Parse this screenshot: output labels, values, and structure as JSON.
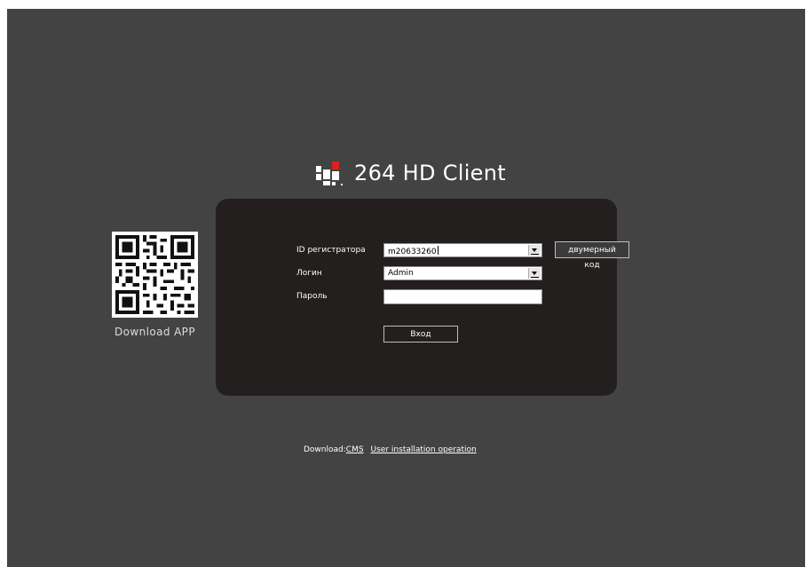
{
  "app": {
    "title": "264 HD Client"
  },
  "qr": {
    "caption": "Download APP"
  },
  "login": {
    "device_id_label": "ID регистратора",
    "device_id_value": "m20633260",
    "qr_code_button": "двумерный код",
    "login_label": "Логин",
    "login_value": "Admin",
    "password_label": "Пароль",
    "password_value": "",
    "submit_label": "Вход"
  },
  "footer": {
    "download_prefix": "Download:",
    "cms_link": "CMS",
    "install_link": "User installation operation"
  },
  "colors": {
    "background": "#434343",
    "panel": "#231f1e",
    "logo_red": "#e0201b",
    "text": "#ffffff"
  },
  "icons": {
    "logo": "brand-logo-icon",
    "qr": "qr-code-icon",
    "dropdown": "chevron-down-icon"
  }
}
